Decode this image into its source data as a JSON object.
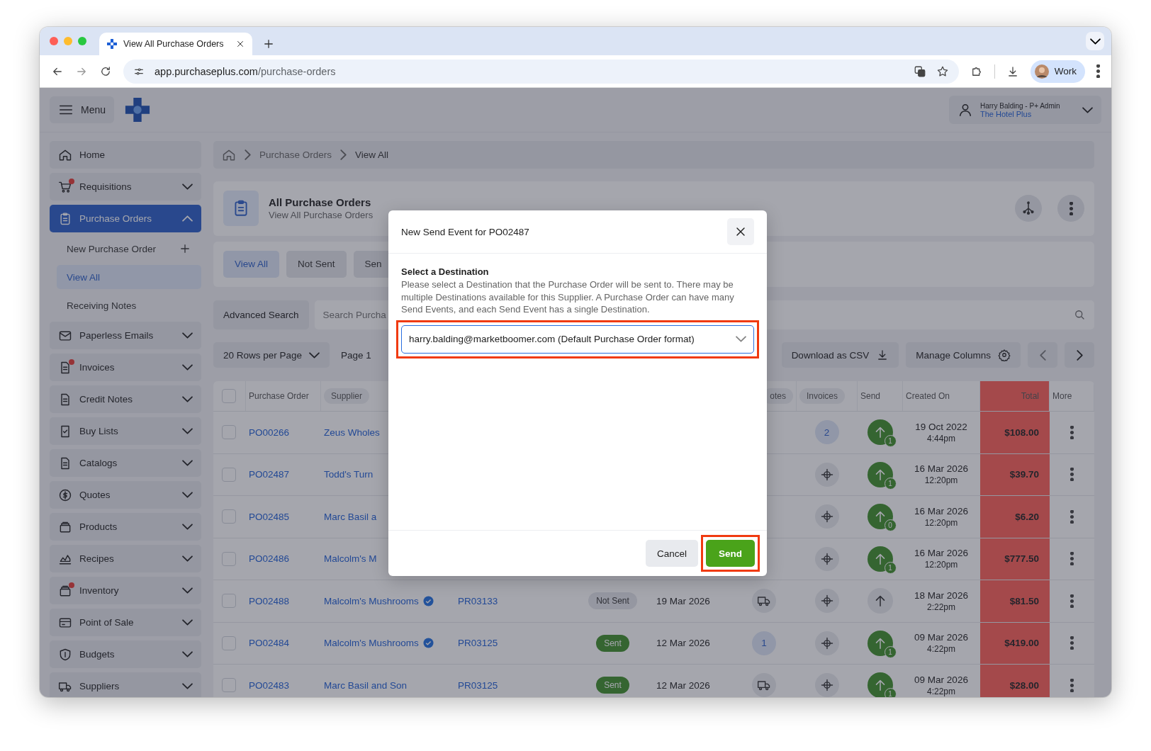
{
  "browser": {
    "tab_title": "View All Purchase Orders",
    "url_domain": "app.purchaseplus.com",
    "url_path": "/purchase-orders",
    "profile": "Work"
  },
  "header": {
    "menu_label": "Menu",
    "user_name": "Harry Balding - P+ Admin",
    "organisation": "The Hotel Plus"
  },
  "sidebar": {
    "items": [
      {
        "label": "Home",
        "kind": "link",
        "notification": false,
        "selected": false
      },
      {
        "label": "Requisitions",
        "kind": "group",
        "notification": true,
        "selected": false,
        "expanded": false
      },
      {
        "label": "Purchase Orders",
        "kind": "group",
        "notification": false,
        "selected": true,
        "expanded": true,
        "children": [
          {
            "label": "New Purchase Order",
            "kind": "action",
            "selected": false
          },
          {
            "label": "View All",
            "kind": "link",
            "selected": true
          },
          {
            "label": "Receiving Notes",
            "kind": "link",
            "selected": false
          }
        ]
      },
      {
        "label": "Paperless Emails",
        "kind": "group",
        "notification": false,
        "selected": false,
        "expanded": false
      },
      {
        "label": "Invoices",
        "kind": "group",
        "notification": true,
        "selected": false,
        "expanded": false
      },
      {
        "label": "Credit Notes",
        "kind": "group",
        "notification": false,
        "selected": false,
        "expanded": false
      },
      {
        "label": "Buy Lists",
        "kind": "group",
        "notification": false,
        "selected": false,
        "expanded": false
      },
      {
        "label": "Catalogs",
        "kind": "group",
        "notification": false,
        "selected": false,
        "expanded": false
      },
      {
        "label": "Quotes",
        "kind": "group",
        "notification": false,
        "selected": false,
        "expanded": false
      },
      {
        "label": "Products",
        "kind": "group",
        "notification": false,
        "selected": false,
        "expanded": false
      },
      {
        "label": "Recipes",
        "kind": "group",
        "notification": false,
        "selected": false,
        "expanded": false
      },
      {
        "label": "Inventory",
        "kind": "group",
        "notification": true,
        "selected": false,
        "expanded": false
      },
      {
        "label": "Point of Sale",
        "kind": "group",
        "notification": false,
        "selected": false,
        "expanded": false
      },
      {
        "label": "Budgets",
        "kind": "group",
        "notification": false,
        "selected": false,
        "expanded": false
      },
      {
        "label": "Suppliers",
        "kind": "group",
        "notification": false,
        "selected": false,
        "expanded": false
      }
    ]
  },
  "breadcrumb": [
    "Purchase Orders",
    "View All"
  ],
  "page_header": {
    "title": "All Purchase Orders",
    "subtitle": "View All Purchase Orders"
  },
  "tabs": [
    {
      "label": "View All",
      "selected": true
    },
    {
      "label": "Not Sent",
      "selected": false
    },
    {
      "label": "Sen",
      "selected": false
    }
  ],
  "search": {
    "button": "Advanced Search",
    "placeholder": "Search Purcha"
  },
  "pagination": {
    "rows_per_page": "20 Rows per Page",
    "page": "Page 1",
    "download": "Download as CSV",
    "manage_columns": "Manage Columns"
  },
  "table": {
    "select_all": {
      "checked": false
    },
    "columns": [
      {
        "label": "Purchase Order",
        "kind": "plain"
      },
      {
        "label": "Supplier",
        "kind": "pill"
      },
      {
        "kind": "hidden"
      },
      {
        "kind": "hidden"
      },
      {
        "kind": "hidden"
      },
      {
        "label": "otes",
        "kind": "pill"
      },
      {
        "label": "Invoices",
        "kind": "pill"
      },
      {
        "label": "Send",
        "kind": "plain"
      },
      {
        "label": "Created On",
        "kind": "plain"
      },
      {
        "label": "Total",
        "kind": "right"
      },
      {
        "label": "More",
        "kind": "plain"
      }
    ],
    "rows": [
      {
        "checked": false,
        "po": "PO00266",
        "supplier": "Zeus Wholes",
        "invoices": {
          "kind": "count",
          "value": "2"
        },
        "send": {
          "sent": true,
          "count": "1"
        },
        "created_date": "19 Oct 2022",
        "created_time": "4:44pm",
        "total": "$108.00"
      },
      {
        "checked": false,
        "po": "PO02487",
        "supplier": "Todd's Turn",
        "invoices": {
          "kind": "crosshair"
        },
        "send": {
          "sent": true,
          "count": "1"
        },
        "created_date": "16 Mar 2026",
        "created_time": "12:20pm",
        "total": "$39.70"
      },
      {
        "checked": false,
        "po": "PO02485",
        "supplier": "Marc Basil a",
        "invoices": {
          "kind": "crosshair"
        },
        "send": {
          "sent": true,
          "count": "0"
        },
        "created_date": "16 Mar 2026",
        "created_time": "12:20pm",
        "total": "$6.20"
      },
      {
        "checked": false,
        "po": "PO02486",
        "supplier": "Malcolm's M",
        "invoices": {
          "kind": "crosshair"
        },
        "send": {
          "sent": true,
          "count": "1"
        },
        "created_date": "16 Mar 2026",
        "created_time": "12:20pm",
        "total": "$777.50"
      },
      {
        "checked": false,
        "po": "PO02488",
        "supplier": "Malcolm's Mushrooms",
        "verified": true,
        "requisition": "PR03133",
        "status": {
          "label": "Not Sent",
          "sent": false
        },
        "date": "19 Mar 2026",
        "notes": {
          "kind": "truck"
        },
        "invoices": {
          "kind": "crosshair"
        },
        "send": {
          "sent": false
        },
        "created_date": "18 Mar 2026",
        "created_time": "2:22pm",
        "total": "$81.50"
      },
      {
        "checked": false,
        "po": "PO02484",
        "supplier": "Malcolm's Mushrooms",
        "verified": true,
        "requisition": "PR03125",
        "status": {
          "label": "Sent",
          "sent": true
        },
        "date": "12 Mar 2026",
        "notes": {
          "kind": "count",
          "value": "1"
        },
        "invoices": {
          "kind": "crosshair"
        },
        "send": {
          "sent": true,
          "count": "1"
        },
        "created_date": "09 Mar 2026",
        "created_time": "4:22pm",
        "total": "$419.00"
      },
      {
        "checked": false,
        "po": "PO02483",
        "supplier": "Marc Basil and Son",
        "verified": false,
        "requisition": "PR03125",
        "status": {
          "label": "Sent",
          "sent": true
        },
        "date": "12 Mar 2026",
        "notes": {
          "kind": "truck"
        },
        "invoices": {
          "kind": "crosshair"
        },
        "send": {
          "sent": true,
          "count": "1"
        },
        "created_date": "09 Mar 2026",
        "created_time": "4:22pm",
        "total": "$28.00"
      }
    ]
  },
  "modal": {
    "title": "New Send Event for PO02487",
    "heading": "Select a Destination",
    "description": "Please select a Destination that the Purchase Order will be sent to. There may be multiple Destinations available for this Supplier. A Purchase Order can have many Send Events, and each Send Event has a single Destination.",
    "destination": "harry.balding@marketboomer.com (Default Purchase Order format)",
    "highlighted": true,
    "cancel": "Cancel",
    "send": "Send"
  }
}
